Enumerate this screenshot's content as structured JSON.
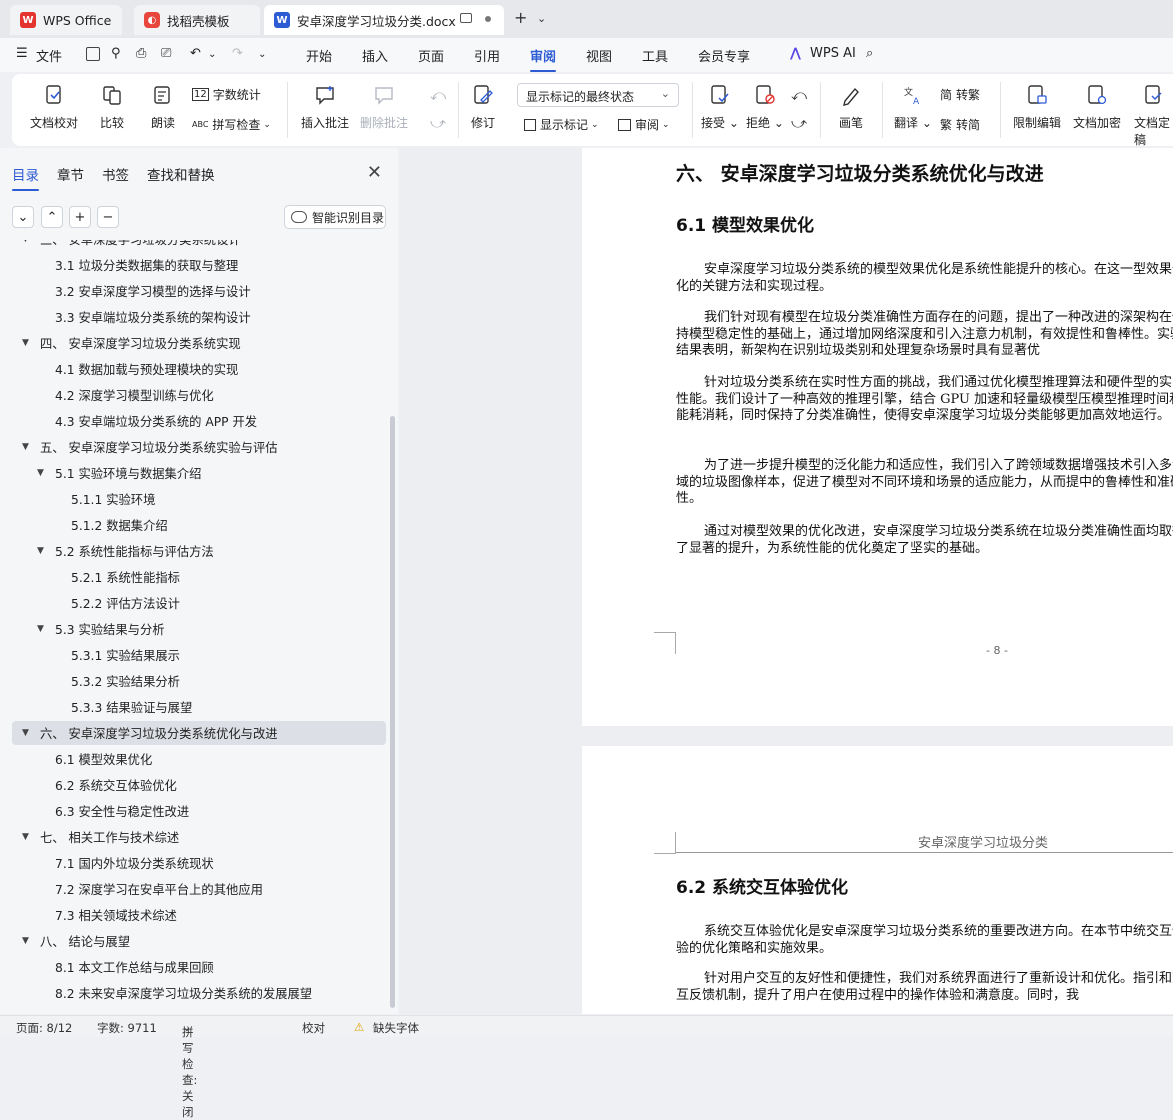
{
  "tabs": [
    {
      "label": "WPS Office",
      "icon": "wps-logo-icon"
    },
    {
      "label": "找稻壳模板",
      "icon": "docer-icon"
    },
    {
      "label": "安卓深度学习垃圾分类.docx",
      "icon": "word-doc-icon"
    }
  ],
  "menu": {
    "file": "文件",
    "items": [
      "开始",
      "插入",
      "页面",
      "引用",
      "审阅",
      "视图",
      "工具",
      "会员专享"
    ],
    "active": "审阅",
    "ai": "WPS AI"
  },
  "ribbon": {
    "doc_check": "文档校对",
    "compare": "比较",
    "read_aloud": "朗读",
    "word_count": "字数统计",
    "spell_check": "拼写检查",
    "insert_comment": "插入批注",
    "delete_comment": "删除批注",
    "track_changes": "修订",
    "markup_state": "显示标记的最终状态",
    "show_markup": "显示标记",
    "review": "审阅",
    "accept": "接受",
    "reject": "拒绝",
    "pen": "画笔",
    "translate": "翻译",
    "to_traditional": "转繁",
    "to_simplified": "转简",
    "restrict_edit": "限制编辑",
    "encrypt": "文档加密",
    "finalize": "文档定稿"
  },
  "panel": {
    "tabs": [
      "目录",
      "章节",
      "书签",
      "查找和替换"
    ],
    "smart_toc": "智能识别目录",
    "toc": [
      {
        "text": "三、 安卓深度学习垃圾分类系统设计",
        "level": 1,
        "arrow": "▼"
      },
      {
        "text": "3.1 垃圾分类数据集的获取与整理",
        "level": 2,
        "arrow": ""
      },
      {
        "text": "3.2 安卓深度学习模型的选择与设计",
        "level": 2,
        "arrow": ""
      },
      {
        "text": "3.3 安卓端垃圾分类系统的架构设计",
        "level": 2,
        "arrow": ""
      },
      {
        "text": "四、 安卓深度学习垃圾分类系统实现",
        "level": 1,
        "arrow": "▼"
      },
      {
        "text": "4.1 数据加载与预处理模块的实现",
        "level": 2,
        "arrow": ""
      },
      {
        "text": "4.2 深度学习模型训练与优化",
        "level": 2,
        "arrow": ""
      },
      {
        "text": "4.3 安卓端垃圾分类系统的 APP 开发",
        "level": 2,
        "arrow": ""
      },
      {
        "text": "五、 安卓深度学习垃圾分类系统实验与评估",
        "level": 1,
        "arrow": "▼"
      },
      {
        "text": "5.1 实验环境与数据集介绍",
        "level": 2,
        "arrow": "▼"
      },
      {
        "text": "5.1.1 实验环境",
        "level": 3,
        "arrow": ""
      },
      {
        "text": "5.1.2 数据集介绍",
        "level": 3,
        "arrow": ""
      },
      {
        "text": "5.2 系统性能指标与评估方法",
        "level": 2,
        "arrow": "▼"
      },
      {
        "text": "5.2.1 系统性能指标",
        "level": 3,
        "arrow": ""
      },
      {
        "text": "5.2.2 评估方法设计",
        "level": 3,
        "arrow": ""
      },
      {
        "text": "5.3 实验结果与分析",
        "level": 2,
        "arrow": "▼"
      },
      {
        "text": "5.3.1 实验结果展示",
        "level": 3,
        "arrow": ""
      },
      {
        "text": "5.3.2 实验结果分析",
        "level": 3,
        "arrow": ""
      },
      {
        "text": "5.3.3 结果验证与展望",
        "level": 3,
        "arrow": ""
      },
      {
        "text": "六、 安卓深度学习垃圾分类系统优化与改进",
        "level": 1,
        "arrow": "▼",
        "selected": true
      },
      {
        "text": "6.1 模型效果优化",
        "level": 2,
        "arrow": ""
      },
      {
        "text": "6.2 系统交互体验优化",
        "level": 2,
        "arrow": ""
      },
      {
        "text": "6.3 安全性与稳定性改进",
        "level": 2,
        "arrow": ""
      },
      {
        "text": "七、 相关工作与技术综述",
        "level": 1,
        "arrow": "▼"
      },
      {
        "text": "7.1 国内外垃圾分类系统现状",
        "level": 2,
        "arrow": ""
      },
      {
        "text": "7.2 深度学习在安卓平台上的其他应用",
        "level": 2,
        "arrow": ""
      },
      {
        "text": "7.3 相关领域技术综述",
        "level": 2,
        "arrow": ""
      },
      {
        "text": "八、 结论与展望",
        "level": 1,
        "arrow": "▼"
      },
      {
        "text": "8.1 本文工作总结与成果回顾",
        "level": 2,
        "arrow": ""
      },
      {
        "text": "8.2 未来安卓深度学习垃圾分类系统的发展展望",
        "level": 2,
        "arrow": ""
      }
    ]
  },
  "document": {
    "page1": {
      "heading": "六、 安卓深度学习垃圾分类系统优化与改进",
      "subheading": "6.1 模型效果优化",
      "paragraphs": [
        "安卓深度学习垃圾分类系统的模型效果优化是系统性能提升的核心。在这一型效果优化的关键方法和实现过程。",
        "我们针对现有模型在垃圾分类准确性方面存在的问题，提出了一种改进的深架构在保持模型稳定性的基础上，通过增加网络深度和引入注意力机制，有效提性和鲁棒性。实验结果表明，新架构在识别垃圾类别和处理复杂场景时具有显著优",
        "针对垃圾分类系统在实时性方面的挑战，我们通过优化模型推理算法和硬件型的实时性能。我们设计了一种高效的推理引擎，结合 GPU 加速和轻量级模型压模型推理时间和能耗消耗，同时保持了分类准确性，使得安卓深度学习垃圾分类能够更加高效地运行。",
        "为了进一步提升模型的泛化能力和适应性，我们引入了跨领域数据增强技术引入多领域的垃圾图像样本，促进了模型对不同环境和场景的适应能力，从而提中的鲁棒性和准确性。",
        "通过对模型效果的优化改进，安卓深度学习垃圾分类系统在垃圾分类准确性面均取得了显著的提升，为系统性能的优化奠定了坚实的基础。"
      ],
      "page_number": "- 8 -"
    },
    "page2": {
      "header": "安卓深度学习垃圾分类",
      "subheading": "6.2 系统交互体验优化",
      "paragraphs": [
        "系统交互体验优化是安卓深度学习垃圾分类系统的重要改进方向。在本节中统交互体验的优化策略和实施效果。",
        "针对用户交互的友好性和便捷性，我们对系统界面进行了重新设计和优化。指引和交互反馈机制，提升了用户在使用过程中的操作体验和满意度。同时，我"
      ]
    }
  },
  "status": {
    "page": "页面: 8/12",
    "words": "字数: 9711",
    "spell": "拼写检查: 关闭",
    "proof": "校对",
    "missing_font": "缺失字体"
  },
  "colors": {
    "accent": "#2d5bd3",
    "wps_red": "#e3342f"
  }
}
